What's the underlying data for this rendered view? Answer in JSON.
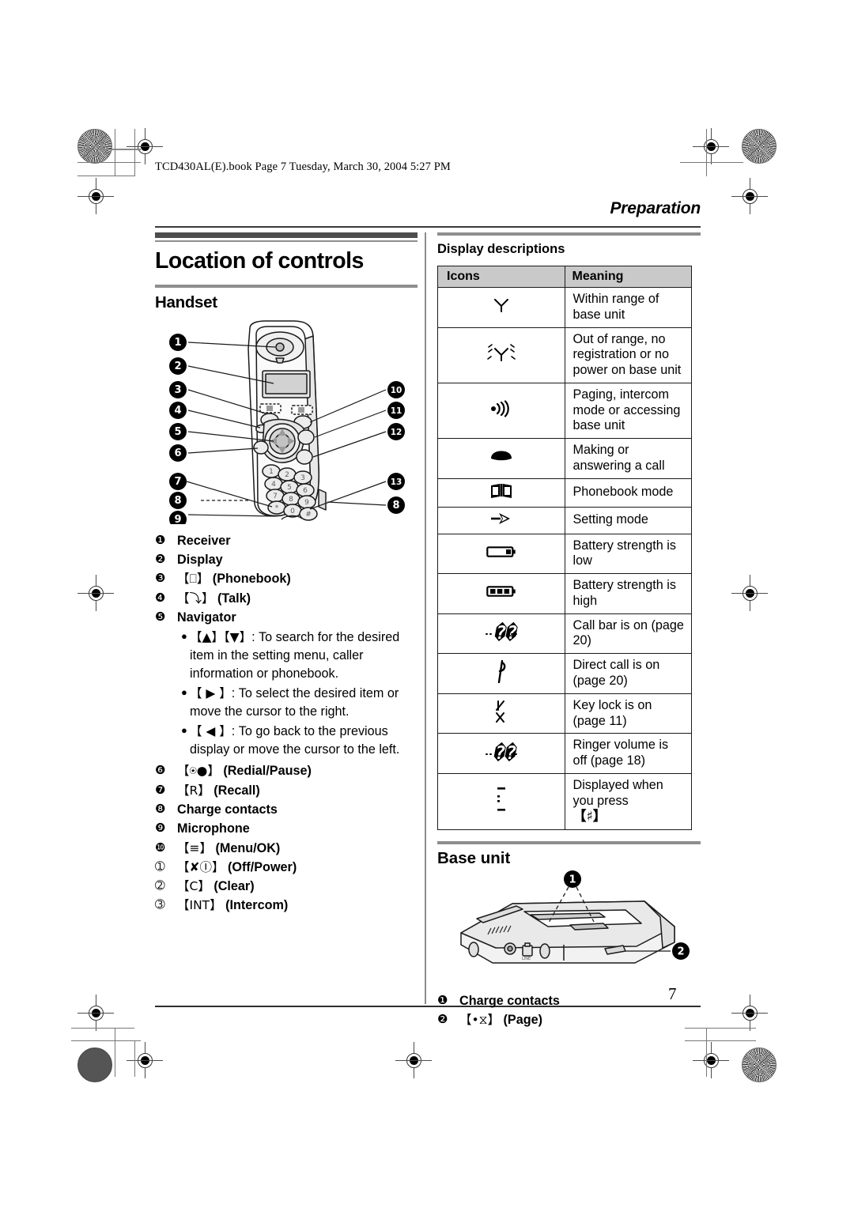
{
  "print_header": {
    "book_line": "TCD430AL(E).book  Page 7  Tuesday, March 30, 2004  5:27 PM"
  },
  "running_head": "Preparation",
  "page_number": "7",
  "left_column": {
    "title": "Location of controls",
    "section_heading": "Handset",
    "callouts": [
      {
        "num": "❶",
        "label": "Receiver"
      },
      {
        "num": "❷",
        "label": "Display"
      },
      {
        "num": "❸",
        "key": "【⎕】",
        "label": " (Phonebook)"
      },
      {
        "num": "❹",
        "key": "【⤵】",
        "label": " (Talk)"
      },
      {
        "num": "❺",
        "label": "Navigator"
      },
      {
        "num": "❻",
        "key": "【⍟●】",
        "label": " (Redial/Pause)"
      },
      {
        "num": "❼",
        "key": "【R】",
        "label": " (Recall)"
      },
      {
        "num": "❽",
        "label": "Charge contacts"
      },
      {
        "num": "❾",
        "label": "Microphone"
      },
      {
        "num": "❿",
        "key": "【≡】",
        "label": " (Menu/OK)"
      },
      {
        "num": "➀",
        "key": "【✘Ⓘ】",
        "label": " (Off/Power)"
      },
      {
        "num": "➁",
        "key": "【C】",
        "label": " (Clear)"
      },
      {
        "num": "➂",
        "key": "【INT】",
        "label": " (Intercom)"
      }
    ],
    "navigator_bullets": [
      {
        "key": "【▲】【▼】",
        "text": ": To search for the desired item in the setting menu, caller information or phonebook."
      },
      {
        "key": "【 ▶ 】",
        "text": ": To select the desired item or move the cursor to the right."
      },
      {
        "key": "【 ◀ 】",
        "text": ": To go back to the previous display or move the cursor to the left."
      }
    ],
    "handset_figure_labels": {
      "left": [
        "1",
        "2",
        "3",
        "4",
        "5",
        "6",
        "7",
        "8",
        "9"
      ],
      "right": [
        "10",
        "11",
        "12",
        "13",
        "8"
      ]
    }
  },
  "right_column": {
    "display_descriptions_heading": "Display descriptions",
    "table": {
      "headers": [
        "Icons",
        "Meaning"
      ],
      "rows": [
        {
          "icon": "antenna-in-range-icon",
          "meaning": "Within range of base unit"
        },
        {
          "icon": "antenna-out-of-range-icon",
          "meaning": "Out of range, no registration or no power on base unit"
        },
        {
          "icon": "paging-icon",
          "meaning": "Paging, intercom mode or accessing base unit"
        },
        {
          "icon": "handset-call-icon",
          "meaning": "Making or answering a call"
        },
        {
          "icon": "phonebook-icon",
          "meaning": "Phonebook mode"
        },
        {
          "icon": "setting-mode-arrow-icon",
          "meaning": "Setting mode"
        },
        {
          "icon": "battery-low-icon",
          "meaning": "Battery strength is low"
        },
        {
          "icon": "battery-high-icon",
          "meaning": "Battery strength is high"
        },
        {
          "icon": "call-bar-icon",
          "meaning": "Call bar is on (page 20)"
        },
        {
          "icon": "direct-call-icon",
          "meaning": "Direct call is on (page 20)"
        },
        {
          "icon": "key-lock-icon",
          "meaning": "Key lock is on (page 11)"
        },
        {
          "icon": "ringer-off-icon",
          "meaning": "Ringer volume is off (page 18)"
        },
        {
          "icon": "hash-press-icon",
          "meaning": "Displayed when you press",
          "meaning_key": "【♯】"
        }
      ]
    },
    "base_unit_heading": "Base unit",
    "base_callouts": [
      {
        "num": "❶",
        "label": "Charge contacts"
      },
      {
        "num": "❷",
        "key": "【•⧖】",
        "label": " (Page)"
      }
    ],
    "base_figure_labels": [
      "1",
      "2"
    ]
  }
}
